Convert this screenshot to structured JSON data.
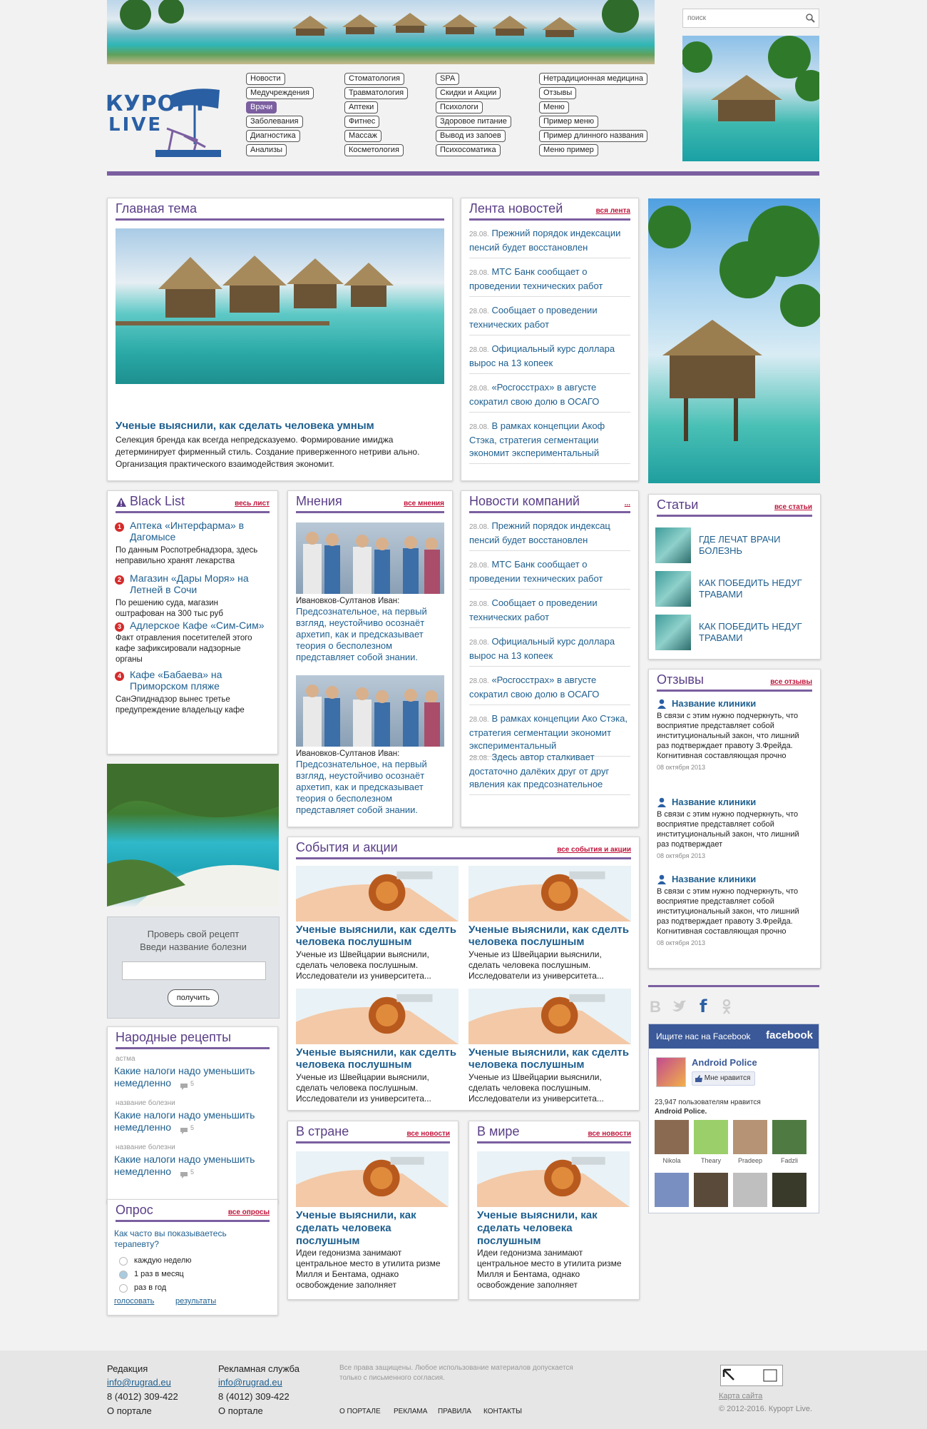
{
  "search": {
    "placeholder": "поиск"
  },
  "logo": {
    "line1": "КУРОРТ",
    "line2": "LIVE"
  },
  "nav": {
    "col1": [
      "Новости",
      "Медучреждения",
      "Врачи",
      "Заболевания",
      "Диагностика",
      "Анализы"
    ],
    "col2": [
      "Стоматология",
      "Травматология",
      "Аптеки",
      "Фитнес",
      "Массаж",
      "Косметология"
    ],
    "col3": [
      "SPA",
      "Скидки и Акции",
      "Психологи",
      "Здоровое питание",
      "Вывод из запоев",
      "Психосоматика"
    ],
    "col4": [
      "Нетрадиционная медицина",
      "Отзывы",
      "Меню",
      "Пример меню",
      "Пример длинного названия",
      "Меню пример"
    ],
    "active": "Врачи"
  },
  "main_topic": {
    "title": "Главная тема",
    "headline": "Ученые выяснили, как сделать человека умным",
    "text": "Селекция бренда как всегда непредсказуемо. Формирование имиджа детерминирует фирменный стиль. Создание приверженного нетриви ально. Организация практического взаимодействия экономит."
  },
  "newsfeed": {
    "title": "Лента новостей",
    "link": "вся лента",
    "items": [
      {
        "date": "28.08.",
        "text": "Прежний порядок индексации пенсий будет восстановлен"
      },
      {
        "date": "28.08.",
        "text": "МТС Банк сообщает о проведении технических работ"
      },
      {
        "date": "28.08.",
        "text": "Сообщает о проведении технических работ"
      },
      {
        "date": "28.08.",
        "text": "Официальный курс доллара вырос на 13 копеек"
      },
      {
        "date": "28.08.",
        "text": "«Росгосстрах» в августе сократил свою долю в ОСАГО"
      },
      {
        "date": "28.08.",
        "text": "В рамках концепции Акоф Стэка, стратегия сегментации экономит экспериментальный"
      }
    ]
  },
  "blacklist": {
    "title": "Black List",
    "link": "весь лист",
    "items": [
      {
        "num": "1",
        "title": "Аптека «Интерфарма» в Дагомысе",
        "text": "По данным Роспотребнадзора, здесь неправильно хранят лекарства"
      },
      {
        "num": "2",
        "title": "Магазин «Дары Моря» на Летней в Сочи",
        "text": "По решению суда, магазин оштрафован на 300 тыс руб"
      },
      {
        "num": "3",
        "title": "Адлерское Кафе «Сим-Сим»",
        "text": "Факт отравления посетителей этого кафе зафиксировали надзорные органы"
      },
      {
        "num": "4",
        "title": "Кафе «Бабаева» на Приморском пляже",
        "text": "СанЭпиднадзор вынес третье предупреждение владельцу кафе"
      }
    ]
  },
  "opinions": {
    "title": "Мнения",
    "link": "все мнения",
    "items": [
      {
        "author": "Ивановков-Султанов Иван:",
        "text": "Предсознательное, на первый взгляд, неустойчиво осознаёт архетип, как и предсказывает теория о бесполезном представляет собой знании."
      },
      {
        "author": "Ивановков-Султанов Иван:",
        "text": "Предсознательное, на первый взгляд, неустойчиво осознаёт архетип, как и предсказывает теория о бесполезном представляет собой знании."
      }
    ]
  },
  "company_news": {
    "title": "Новости компаний",
    "link": "...",
    "items": [
      {
        "date": "28.08.",
        "text": "Прежний порядок индексац пенсий будет восстановлен"
      },
      {
        "date": "28.08.",
        "text": "МТС Банк сообщает о проведении технических работ"
      },
      {
        "date": "28.08.",
        "text": "Сообщает о проведении технических работ"
      },
      {
        "date": "28.08.",
        "text": "Официальный курс доллара вырос на 13 копеек"
      },
      {
        "date": "28.08.",
        "text": "«Росгосстрах» в августе сократил свою долю в ОСАГО"
      },
      {
        "date": "28.08.",
        "text": "В рамках концепции Ако Стэка, стратегия сегментации экономит экспериментальный"
      },
      {
        "date": "28.08.",
        "text": "Здесь автор сталкивает достаточно далёких друг от друг явления как предсознательное"
      }
    ]
  },
  "articles": {
    "title": "Статьи",
    "link": "все статьи",
    "items": [
      "ГДЕ ЛЕЧАТ ВРАЧИ БОЛЕЗНЬ",
      "КАК ПОБЕДИТЬ НЕДУГ ТРАВАМИ",
      "КАК ПОБЕДИТЬ НЕДУГ ТРАВАМИ"
    ]
  },
  "reviews": {
    "title": "Отзывы",
    "link": "все отзывы",
    "items": [
      {
        "name": "Название клиники",
        "text": "В связи с этим нужно подчеркнуть, что восприятие представляет собой институциональный закон, что лишний раз подтверждает правоту З.Фрейда. Когнитивная составляющая прочно",
        "date": "08 октября 2013"
      },
      {
        "name": "Название клиники",
        "text": "В связи с этим нужно подчеркнуть, что восприятие представляет собой институциональный закон, что лишний раз подтверждает",
        "date": "08 октября 2013"
      },
      {
        "name": "Название клиники",
        "text": "В связи с этим нужно подчеркнуть, что восприятие представляет собой институциональный закон, что лишний раз подтверждает правоту З.Фрейда. Когнитивная составляющая прочно",
        "date": "08 октября 2013"
      }
    ]
  },
  "events": {
    "title": "События и акции",
    "link": "все события и акции",
    "items": [
      {
        "title": "Ученые выяснили, как сделть человека послушным",
        "text": "Ученые из Швейцарии выяснили, сделать человека послушным. Исследователи из университета..."
      },
      {
        "title": "Ученые выяснили, как сделть человека послушным",
        "text": "Ученые из Швейцарии выяснили, сделать человека послушным. Исследователи из университета..."
      },
      {
        "title": "Ученые выяснили, как сделть человека послушным",
        "text": "Ученые из Швейцарии выяснили, сделать человека послушным. Исследователи из университета..."
      },
      {
        "title": "Ученые выяснили, как сделть человека послушным",
        "text": "Ученые из Швейцарии выяснили, сделать человека послушным. Исследователи из университета..."
      }
    ]
  },
  "country": {
    "title": "В стране",
    "link": "все новости",
    "headline": "Ученые выяснили, как сделать человека послушным",
    "text": "Идеи гедонизма занимают центральное место в утилита ризме Милля и Бентама, однако освобождение заполняет"
  },
  "world": {
    "title": "В мире",
    "link": "все новости",
    "headline": "Ученые выяснили, как сделать человека послушным",
    "text": "Идеи гедонизма занимают центральное место в утилита ризме Милля и Бентама, однако освобождение заполняет"
  },
  "recipe_check": {
    "line1": "Проверь свой рецепт",
    "line2": "Введи название болезни",
    "button": "получить"
  },
  "folk": {
    "title": "Народные рецепты",
    "items": [
      {
        "tag": "астма",
        "title": "Какие налоги надо уменьшить немедленно",
        "count": "5"
      },
      {
        "tag": "название болезни",
        "title": "Какие налоги надо уменьшить немедленно",
        "count": "5"
      },
      {
        "tag": "название болезни",
        "title": "Какие налоги надо уменьшить немедленно",
        "count": "5"
      }
    ]
  },
  "poll": {
    "title": "Опрос",
    "link": "все опросы",
    "question": "Как часто вы показываетесь терапевту?",
    "options": [
      "каждую неделю",
      "1 раз в месяц",
      "раз в год"
    ],
    "selected": 1,
    "vote": "голосовать",
    "results": "результаты"
  },
  "social": {
    "icons": [
      "vk-icon",
      "twitter-icon",
      "facebook-icon",
      "odnoklassniki-icon"
    ]
  },
  "facebook": {
    "header": "Ищите нас на Facebook",
    "brand": "facebook",
    "page": "Android Police",
    "like": "Мне нравится",
    "count_text": "23,947 пользователям нравится",
    "count_page": "Android Police.",
    "people": [
      "Nikola",
      "Theary",
      "Pradeep",
      "Fadzli"
    ]
  },
  "footer": {
    "col1": {
      "title": "Редакция",
      "email": "info@rugrad.eu",
      "phone": "8 (4012) 309-422",
      "link": "О портале"
    },
    "col2": {
      "title": "Рекламная служба",
      "email": "info@rugrad.eu",
      "phone": "8 (4012) 309-422",
      "link": "О портале"
    },
    "rights": "Все права защищены. Любое использование материалов допускается только с письменного согласия.",
    "links": [
      "О ПОРТАЛЕ",
      "РЕКЛАМА",
      "ПРАВИЛА",
      "КОНТАКТЫ"
    ],
    "sitemap": "Карта сайта",
    "copyright": "© 2012-2016. Курорт Live."
  },
  "colors": {
    "accent": "#7b5fa0",
    "link": "#1e5f8f",
    "red": "#c0133a"
  }
}
